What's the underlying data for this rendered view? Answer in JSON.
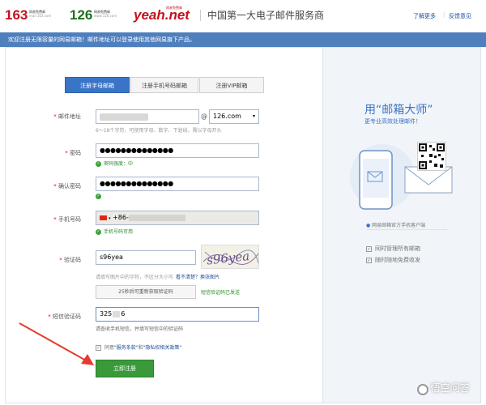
{
  "header": {
    "logo163": {
      "num": "163",
      "sub": "网易免费邮",
      "url": "mail.163.com"
    },
    "logo126": {
      "num": "126",
      "sub": "网易免费邮",
      "url": "www.126.com"
    },
    "yeah": {
      "text": "yeah.net",
      "sub": "网易免费邮"
    },
    "slogan": "中国第一大电子邮件服务商",
    "links": [
      "了解更多",
      "反馈意见"
    ]
  },
  "notice": "欢迎注册无限容量的网易邮箱！邮件地址可以登录使用其他网易旗下产品。",
  "tabs": [
    {
      "label": "注册字母邮箱",
      "active": true
    },
    {
      "label": "注册手机号码邮箱",
      "active": false
    },
    {
      "label": "注册VIP邮箱",
      "active": false
    }
  ],
  "form": {
    "email": {
      "label": "邮件地址",
      "domain": "126.com",
      "hint": "6～18个字符，可使用字母、数字、下划线，需以字母开头"
    },
    "password": {
      "label": "密码",
      "value": "●●●●●●●●●●●●●●",
      "status": "密码强度：中"
    },
    "confirm": {
      "label": "确认密码",
      "value": "●●●●●●●●●●●●●●"
    },
    "phone": {
      "label": "手机号码",
      "prefix": "+86-",
      "status": "手机号码可用"
    },
    "captcha": {
      "label": "验证码",
      "value": "s96yea",
      "hint": "请填写图片中的字符，不区分大小写",
      "refresh_label": "看不清楚？换张图片",
      "image_text": "s96yea"
    },
    "sms_buttons": {
      "resend": "25秒后可重新获取验证码",
      "sent": "短信验证码已发送"
    },
    "sms": {
      "label": "短信验证码",
      "value": "325",
      "value_tail": "6",
      "hint": "请查收手机短信，并填写短信中的验证码"
    },
    "agree": {
      "prefix": "同意",
      "terms": "\"服务条款\"",
      "and": "和",
      "privacy": "\"隐私权相关政策\""
    },
    "submit_label": "立即注册"
  },
  "promo": {
    "title": "用“邮箱大师”",
    "subtitle": "更专业高效处理邮件！",
    "caption": "网易邮箱官方手机客户端",
    "features": [
      "同时管理所有邮箱",
      "随时随地免费收发"
    ]
  },
  "watermark": "悟空问答",
  "colors": {
    "accent": "#3a74c6",
    "brand_red": "#c4121c",
    "success": "#3a9a3a",
    "notice_bar": "#4f7fbd",
    "arrow": "#e63a2e"
  }
}
